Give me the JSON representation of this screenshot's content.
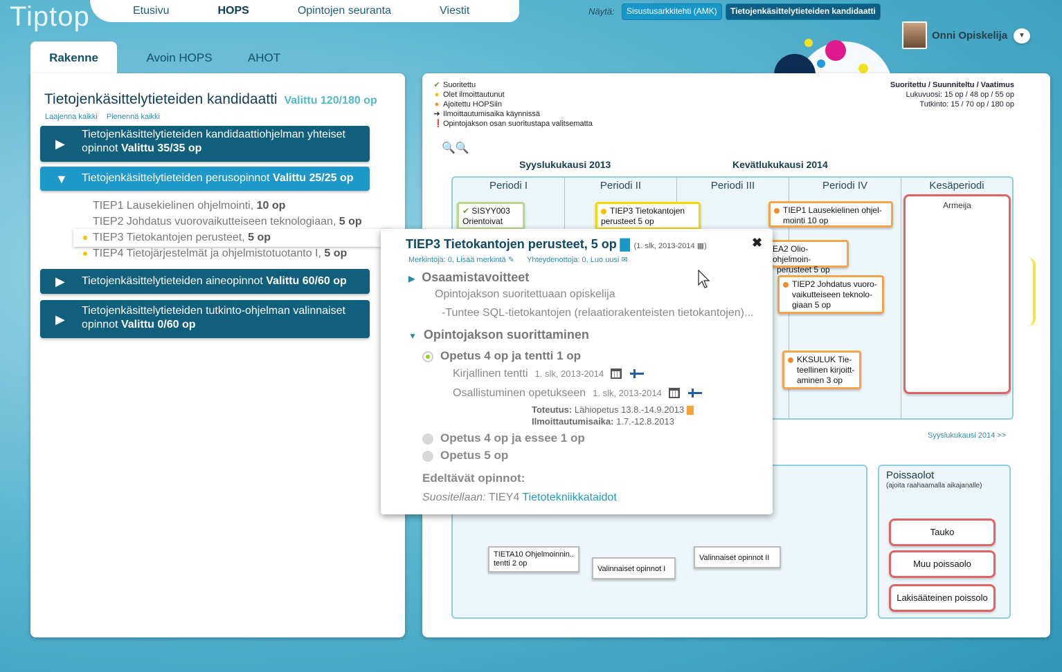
{
  "app": {
    "name": "Tiptop"
  },
  "nav": {
    "items": [
      "Etusivu",
      "HOPS",
      "Opintojen seuranta",
      "Viestit"
    ]
  },
  "show": {
    "label": "Näytä:",
    "degree1": "Sisustusarkkitehti (AMK)",
    "degree2": "Tietojenkäsittelytieteiden kandidaatti"
  },
  "user": {
    "name": "Onni Opiskelija"
  },
  "tabs": [
    "Rakenne",
    "Avoin HOPS",
    "AHOT"
  ],
  "left": {
    "title": "Tietojenkäsittelytieteiden kandidaatti",
    "selected": "Valittu 120/180 op",
    "expand_all": "Laajenna kaikki",
    "collapse_all": "Pienennä kaikki",
    "groups": [
      {
        "line1": "Tietojenkäsittelytieteiden kandidaattiohjelman yhteiset",
        "line2": "opinnot ",
        "sel": "Valittu 35/35 op"
      },
      {
        "line1": "Tietojenkäsittelytieteiden perusopinnot ",
        "sel": "Valittu 25/25 op"
      },
      {
        "line1": "Tietojenkäsittelytieteiden aineopinnot ",
        "sel": "Valittu 60/60 op"
      },
      {
        "line1": "Tietojenkäsittelytieteiden tutkinto-ohjelman valinnaiset",
        "line2": "opinnot ",
        "sel": "Valittu 0/60 op"
      }
    ],
    "courses": [
      {
        "name": "TIEP1 Lausekielinen ohjelmointi, ",
        "op": "10 op"
      },
      {
        "name": "TIEP2 Johdatus vuorovaikutteiseen teknologiaan, ",
        "op": "5 op"
      },
      {
        "name": "TIEP3 Tietokantojen perusteet, ",
        "op": "5 op"
      },
      {
        "name": "TIEP4 Tietojärjestelmät ja ohjelmistotuotanto I, ",
        "op": "5 op"
      }
    ]
  },
  "legend": [
    "Suoritettu",
    "Olet ilmoittautunut",
    "Ajoitettu HOPSiin",
    "Ilmoittautumisaika käynnissä",
    "Opintojakson osan suoritustapa valitsematta"
  ],
  "stats": {
    "head": "Suoritettu / Suunniteltu / Vaatimus",
    "year": "Lukuvuosi: 15 op / 48 op / 55 op",
    "degree": "Tutkinto: 15 / 70 op / 180 op"
  },
  "terms": {
    "t1": "Syyslukukausi 2013",
    "t2": "Kevätlukukausi 2014",
    "next": "Syyslukukausi 2014 >>"
  },
  "periods": [
    "Periodi I",
    "Periodi II",
    "Periodi III",
    "Periodi IV",
    "Kesäperiodi"
  ],
  "boxes": {
    "sisyy": "SISYY003 Orientoivat",
    "tiep3": "TIEP3 Tietokantojen perusteet 5 op",
    "tiep1a": "TIEP1 Lausekielinen ohjel-",
    "tiep1b": "mointi 10 op",
    "ea2a": "EA2 Olio-ohjelmoin-",
    "ea2b": "perusteet 5 op",
    "tiep2a": "TIEP2 Johdatus vuoro-",
    "tiep2b": "vaikutteiseen teknolo-",
    "tiep2c": "giaan 5 op",
    "kksa": "KKSULUK Tie-",
    "kksb": "teellinen kirjoitt-",
    "kksc": "aminen 3 op",
    "army": "Armeija"
  },
  "pool": {
    "b1a": "TIETA10  Ohjelmoinnin..",
    "b1b": "tentti 2 op",
    "b2": "Valinnaiset opinnot I",
    "b3": "Valinnaiset opinnot II"
  },
  "absence": {
    "title": "Poissaolot",
    "sub": "(ajoita raahaamalla aikajanalle)",
    "items": [
      "Tauko",
      "Muu poissaolo",
      "Lakisääteinen poissolo"
    ]
  },
  "popup": {
    "title": "TIEP3 Tietokantojen perusteet, 5 op",
    "year": "(1. slk, 2013-2014",
    "links": "Merkintöjä: 0, Lisää merkintä",
    "contacts": "Yhteydenottoja: 0, Luo uusi",
    "goals": "Osaamistavoitteet",
    "goals_text": "Opintojakson suoritettuaan opiskelija",
    "goals_item": "-Tuntee SQL-tietokantojen (relaatiorakenteisten tietokantojen)...",
    "completion": "Opintojakson suorittaminen",
    "opt1": "Opetus 4 op ja tentti 1 op",
    "exam": "Kirjallinen tentti",
    "exam_time": "1. slk, 2013-2014",
    "teach": "Osallistuminen opetukseen",
    "teach_time": "1. slk, 2013-2014",
    "impl_label": "Toteutus:",
    "impl": "Lähiopetus 13.8.-14.9.2013",
    "reg_label": "Ilmoittautumisaika:",
    "reg": "1.7.-12.8.2013",
    "opt2": "Opetus 4 op ja essee 1 op",
    "opt3": "Opetus 5 op",
    "prereq": "Edeltävät opinnot:",
    "rec_label": "Suositellaan:",
    "rec_code": "TIEY4",
    "rec_link": "Tietotekniikkataidot"
  }
}
